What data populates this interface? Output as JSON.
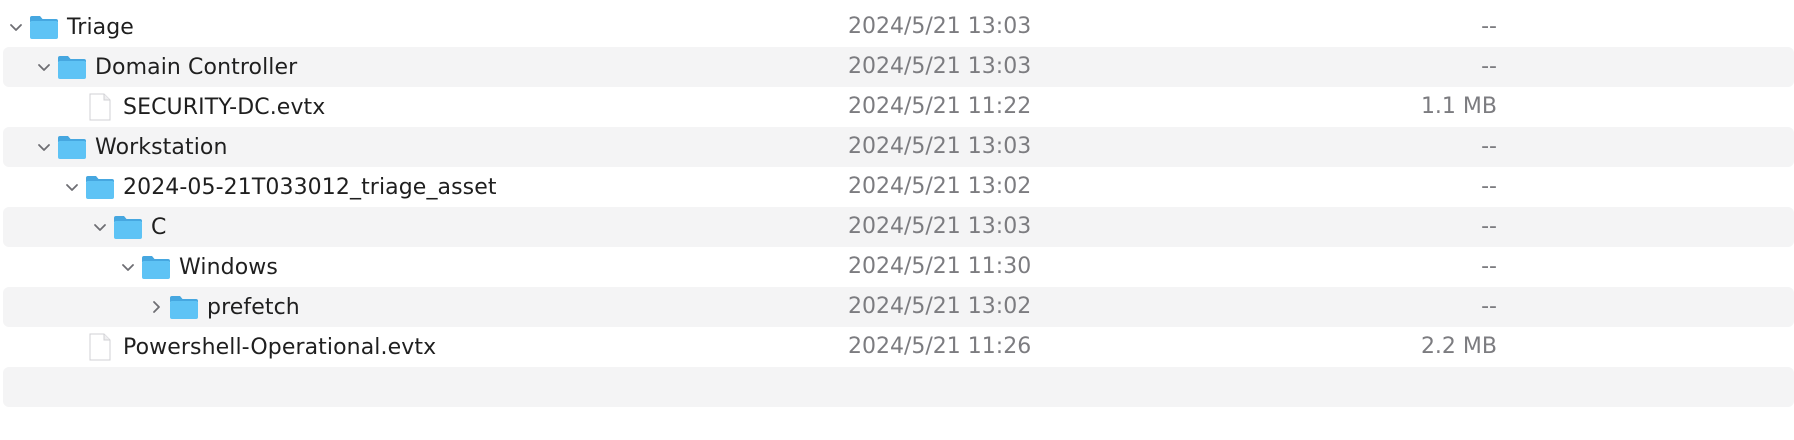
{
  "rows": [
    {
      "name": "Triage",
      "modified": "2024/5/21 13:03",
      "size": "--",
      "kind": "folder",
      "expanded": true,
      "depth": 0
    },
    {
      "name": "Domain Controller",
      "modified": "2024/5/21 13:03",
      "size": "--",
      "kind": "folder",
      "expanded": true,
      "depth": 1
    },
    {
      "name": "SECURITY-DC.evtx",
      "modified": "2024/5/21 11:22",
      "size": "1.1 MB",
      "kind": "file",
      "depth": 2
    },
    {
      "name": "Workstation",
      "modified": "2024/5/21 13:03",
      "size": "--",
      "kind": "folder",
      "expanded": true,
      "depth": 1
    },
    {
      "name": "2024-05-21T033012_triage_asset",
      "modified": "2024/5/21 13:02",
      "size": "--",
      "kind": "folder",
      "expanded": true,
      "depth": 2
    },
    {
      "name": "C",
      "modified": "2024/5/21 13:03",
      "size": "--",
      "kind": "folder",
      "expanded": true,
      "depth": 3
    },
    {
      "name": "Windows",
      "modified": "2024/5/21 11:30",
      "size": "--",
      "kind": "folder",
      "expanded": true,
      "depth": 4
    },
    {
      "name": "prefetch",
      "modified": "2024/5/21 13:02",
      "size": "--",
      "kind": "folder",
      "expanded": false,
      "depth": 5
    },
    {
      "name": "Powershell-Operational.evtx",
      "modified": "2024/5/21 11:26",
      "size": "2.2 MB",
      "kind": "file",
      "depth": 2
    }
  ],
  "icons": {
    "folder": "folder-icon",
    "file": "document-icon",
    "expanded": "chevron-down-icon",
    "collapsed": "chevron-right-icon"
  },
  "colors": {
    "stripe": "#f4f4f5",
    "folder_body": "#5ec3f5",
    "folder_tab": "#46a7e0",
    "text": "#1f1f1f",
    "secondary_text": "#7c7c80"
  }
}
